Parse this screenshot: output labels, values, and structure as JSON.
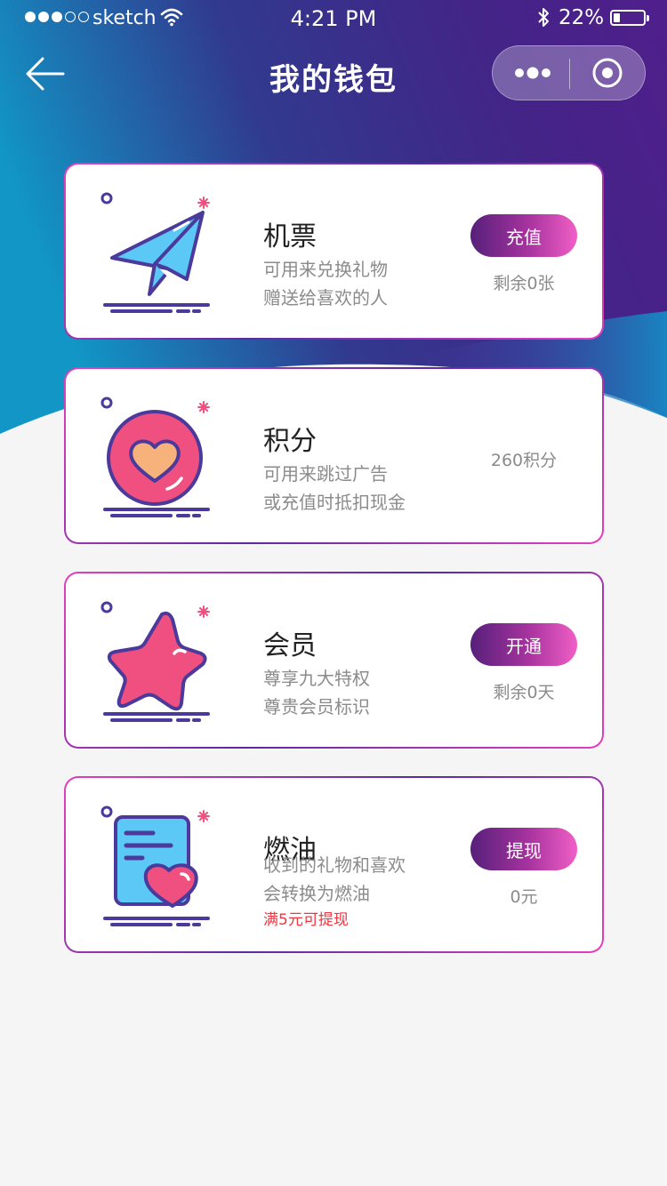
{
  "status_bar": {
    "carrier": "sketch",
    "time": "4:21 PM",
    "battery_percent": "22%",
    "battery_level": 0.22,
    "signal_dots_filled": 3,
    "signal_dots_total": 5
  },
  "nav": {
    "title": "我的钱包",
    "back_icon": "arrow-left-icon",
    "more_icon": "more-dots-icon",
    "close_icon": "target-circle-icon"
  },
  "colors": {
    "hero_gradient": [
      "#1196c5",
      "#3d2e8c",
      "#4a2189"
    ],
    "button_gradient": [
      "#56207a",
      "#a8339f",
      "#f05fc6"
    ],
    "card_border": [
      "#e43fc0",
      "#5b2aa0"
    ],
    "note_red": "#f0353f",
    "icon_pink": "#f0507f",
    "icon_blue": "#5bc8f5",
    "icon_navy": "#4b3a9c"
  },
  "cards": [
    {
      "title": "机票",
      "desc1": "可用来兑换礼物",
      "desc2": "赠送给喜欢的人",
      "action": "充值",
      "remain": "剩余0张",
      "icon": "paper-plane-icon"
    },
    {
      "title": "积分",
      "desc1": "可用来跳过广告",
      "desc2": "或充值时抵扣现金",
      "remain": "260积分",
      "icon": "heart-coin-icon"
    },
    {
      "title": "会员",
      "desc1": "尊享九大特权",
      "desc2": "尊贵会员标识",
      "action": "开通",
      "remain": "剩余0天",
      "icon": "star-icon"
    },
    {
      "title": "燃油",
      "desc1": "收到的礼物和喜欢",
      "desc2": "会转换为燃油",
      "note": "满5元可提现",
      "action": "提现",
      "remain": "0元",
      "icon": "document-heart-icon"
    }
  ]
}
